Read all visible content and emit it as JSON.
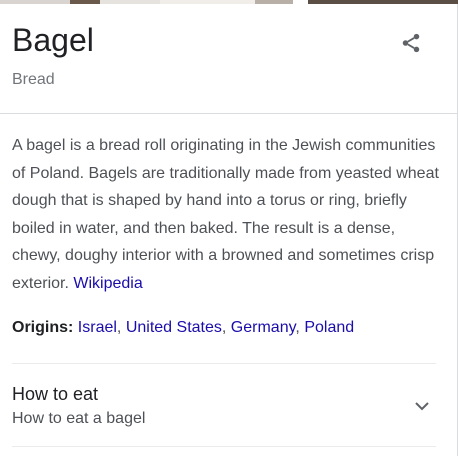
{
  "header": {
    "title": "Bagel",
    "subtitle": "Bread"
  },
  "share": {
    "icon": "share-icon",
    "color": "#5f6368"
  },
  "description": {
    "text": "A bagel is a bread roll originating in the Jewish communities of Poland. Bagels are traditionally made from yeasted wheat dough that is shaped by hand into a torus or ring, briefly boiled in water, and then baked. The result is a dense, chewy, doughy interior with a browned and sometimes crisp exterior.",
    "source_link": "Wikipedia"
  },
  "origins": {
    "label": "Origins:",
    "items": [
      "Israel",
      "United States",
      "Germany",
      "Poland"
    ],
    "separator": ","
  },
  "how_to_eat": {
    "title": "How to eat",
    "subtitle": "How to eat a bagel",
    "icon": "chevron-down-icon"
  },
  "colors": {
    "link": "#1a0dab",
    "text": "#202124",
    "secondary_text": "#4d5156",
    "muted_text": "#70757a",
    "divider": "#dadce0"
  }
}
